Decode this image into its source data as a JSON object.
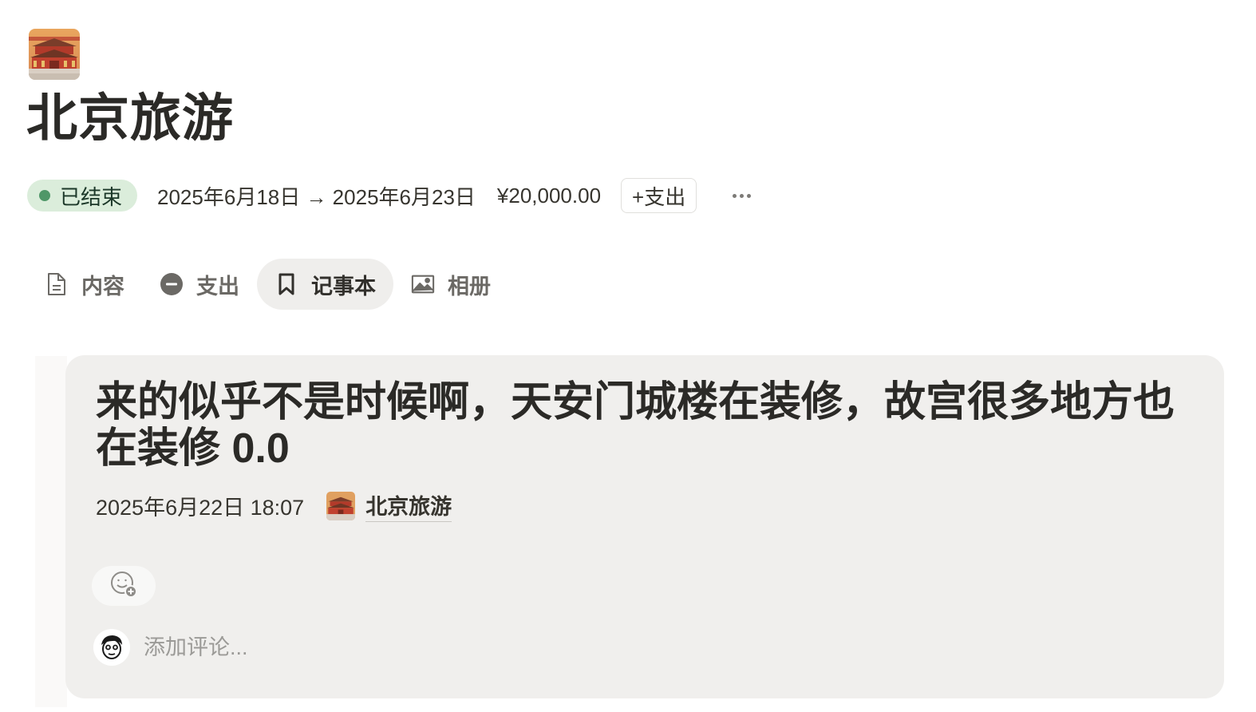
{
  "page": {
    "icon": "forbidden-city-thumbnail",
    "title": "北京旅游"
  },
  "properties": {
    "status": "已结束",
    "status_color": "#4f9768",
    "date_range": "2025年6月18日 → 2025年6月23日",
    "budget": "¥20,000.00",
    "add_expense_label": "+支出",
    "more_icon": "ellipsis-icon"
  },
  "tabs": [
    {
      "label": "内容",
      "icon": "document-icon",
      "active": false
    },
    {
      "label": "支出",
      "icon": "minus-circle-icon",
      "active": false
    },
    {
      "label": "记事本",
      "icon": "bookmark-icon",
      "active": true
    },
    {
      "label": "相册",
      "icon": "image-icon",
      "active": false
    }
  ],
  "note": {
    "title": "来的似乎不是时候啊，天安门城楼在装修，故宫很多地方也在装修 0.0",
    "datetime": "2025年6月22日 18:07",
    "relation": "北京旅游",
    "reaction_icon": "add-reaction-icon",
    "comment_placeholder": "添加评论..."
  }
}
